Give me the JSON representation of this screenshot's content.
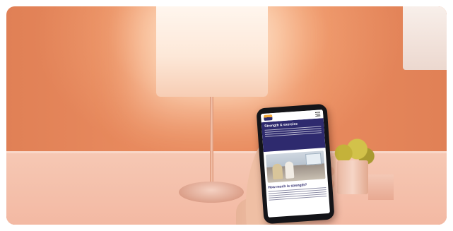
{
  "phone_screen": {
    "hero_title": "Strength & exercise",
    "section_heading": "How much is strength?"
  },
  "colors": {
    "wall": "#ef9a6d",
    "hero_background": "#2e2a6e",
    "logo_accent": "#f2a93b"
  },
  "icons": [
    "brand-logo-icon",
    "hamburger-menu-icon"
  ]
}
